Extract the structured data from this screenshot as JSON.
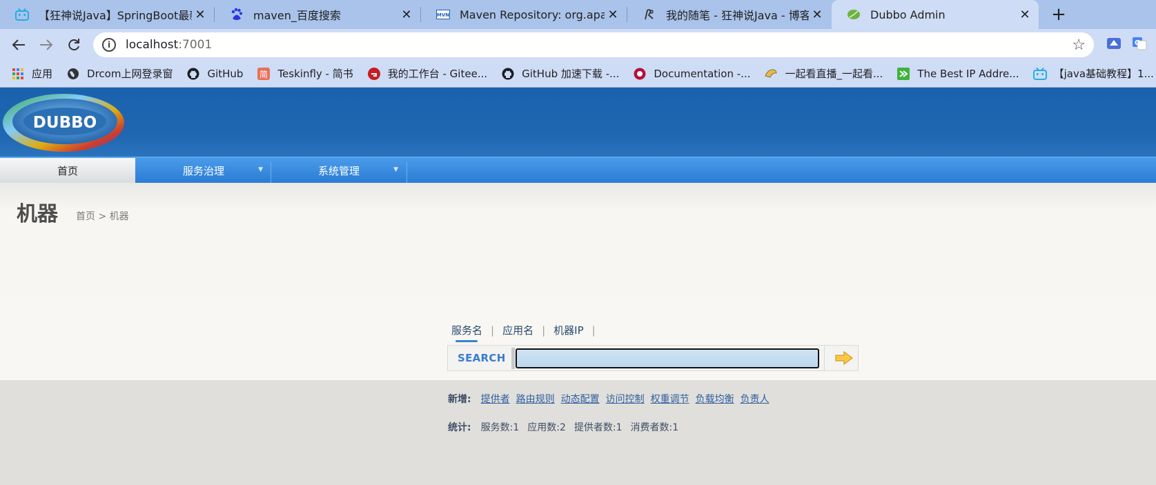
{
  "browser": {
    "tabs": [
      {
        "title": "【狂神说Java】SpringBoot最新教程",
        "icon": "bilibili-icon",
        "active": false
      },
      {
        "title": "maven_百度搜索",
        "icon": "baidu-icon",
        "active": false
      },
      {
        "title": "Maven Repository: org.apache",
        "icon": "mvn-icon",
        "active": false
      },
      {
        "title": "我的随笔 - 狂神说Java - 博客园",
        "icon": "cnblogs-icon",
        "active": false
      },
      {
        "title": "Dubbo Admin",
        "icon": "leaf-icon",
        "active": true
      }
    ],
    "close_glyph": "✕",
    "new_tab_glyph": "+",
    "url_host": "localhost",
    "url_port": ":7001",
    "bookmarks": [
      {
        "label": "应用",
        "icon": "apps-grid-icon"
      },
      {
        "label": "Drcom上网登录窗",
        "icon": "globe-icon"
      },
      {
        "label": "GitHub",
        "icon": "github-icon"
      },
      {
        "label": "Teskinfly - 简书",
        "icon": "jianshu-icon"
      },
      {
        "label": "我的工作台 - Gitee...",
        "icon": "gitee-icon"
      },
      {
        "label": "GitHub 加速下载 -...",
        "icon": "github-icon"
      },
      {
        "label": "Documentation -...",
        "icon": "doc-icon"
      },
      {
        "label": "一起看直播_一起看...",
        "icon": "eagle-icon"
      },
      {
        "label": "The Best IP Addre...",
        "icon": "ip-icon"
      },
      {
        "label": "【java基础教程】1...",
        "icon": "bilibili-icon"
      }
    ]
  },
  "app": {
    "logo_text": "DUBBO",
    "nav": [
      {
        "label": "首页",
        "has_menu": false
      },
      {
        "label": "服务治理",
        "has_menu": true
      },
      {
        "label": "系统管理",
        "has_menu": true
      }
    ],
    "page_title": "机器",
    "breadcrumb": "首页 > 机器",
    "search_tabs": [
      "服务名",
      "应用名",
      "机器IP"
    ],
    "search_label": "SEARCH",
    "search_value": "",
    "new_label": "新增:",
    "new_links": [
      "提供者",
      "路由规则",
      "动态配置",
      "访问控制",
      "权重调节",
      "负载均衡",
      "负责人"
    ],
    "stats_label": "统计:",
    "stats": [
      "服务数:1",
      "应用数:2",
      "提供者数:1",
      "消费者数:1"
    ]
  },
  "colors": {
    "header_blue": "#2067b2",
    "nav_blue": "#3b8de0",
    "link": "#2f5f9e",
    "search_label": "#3a7bd0"
  }
}
